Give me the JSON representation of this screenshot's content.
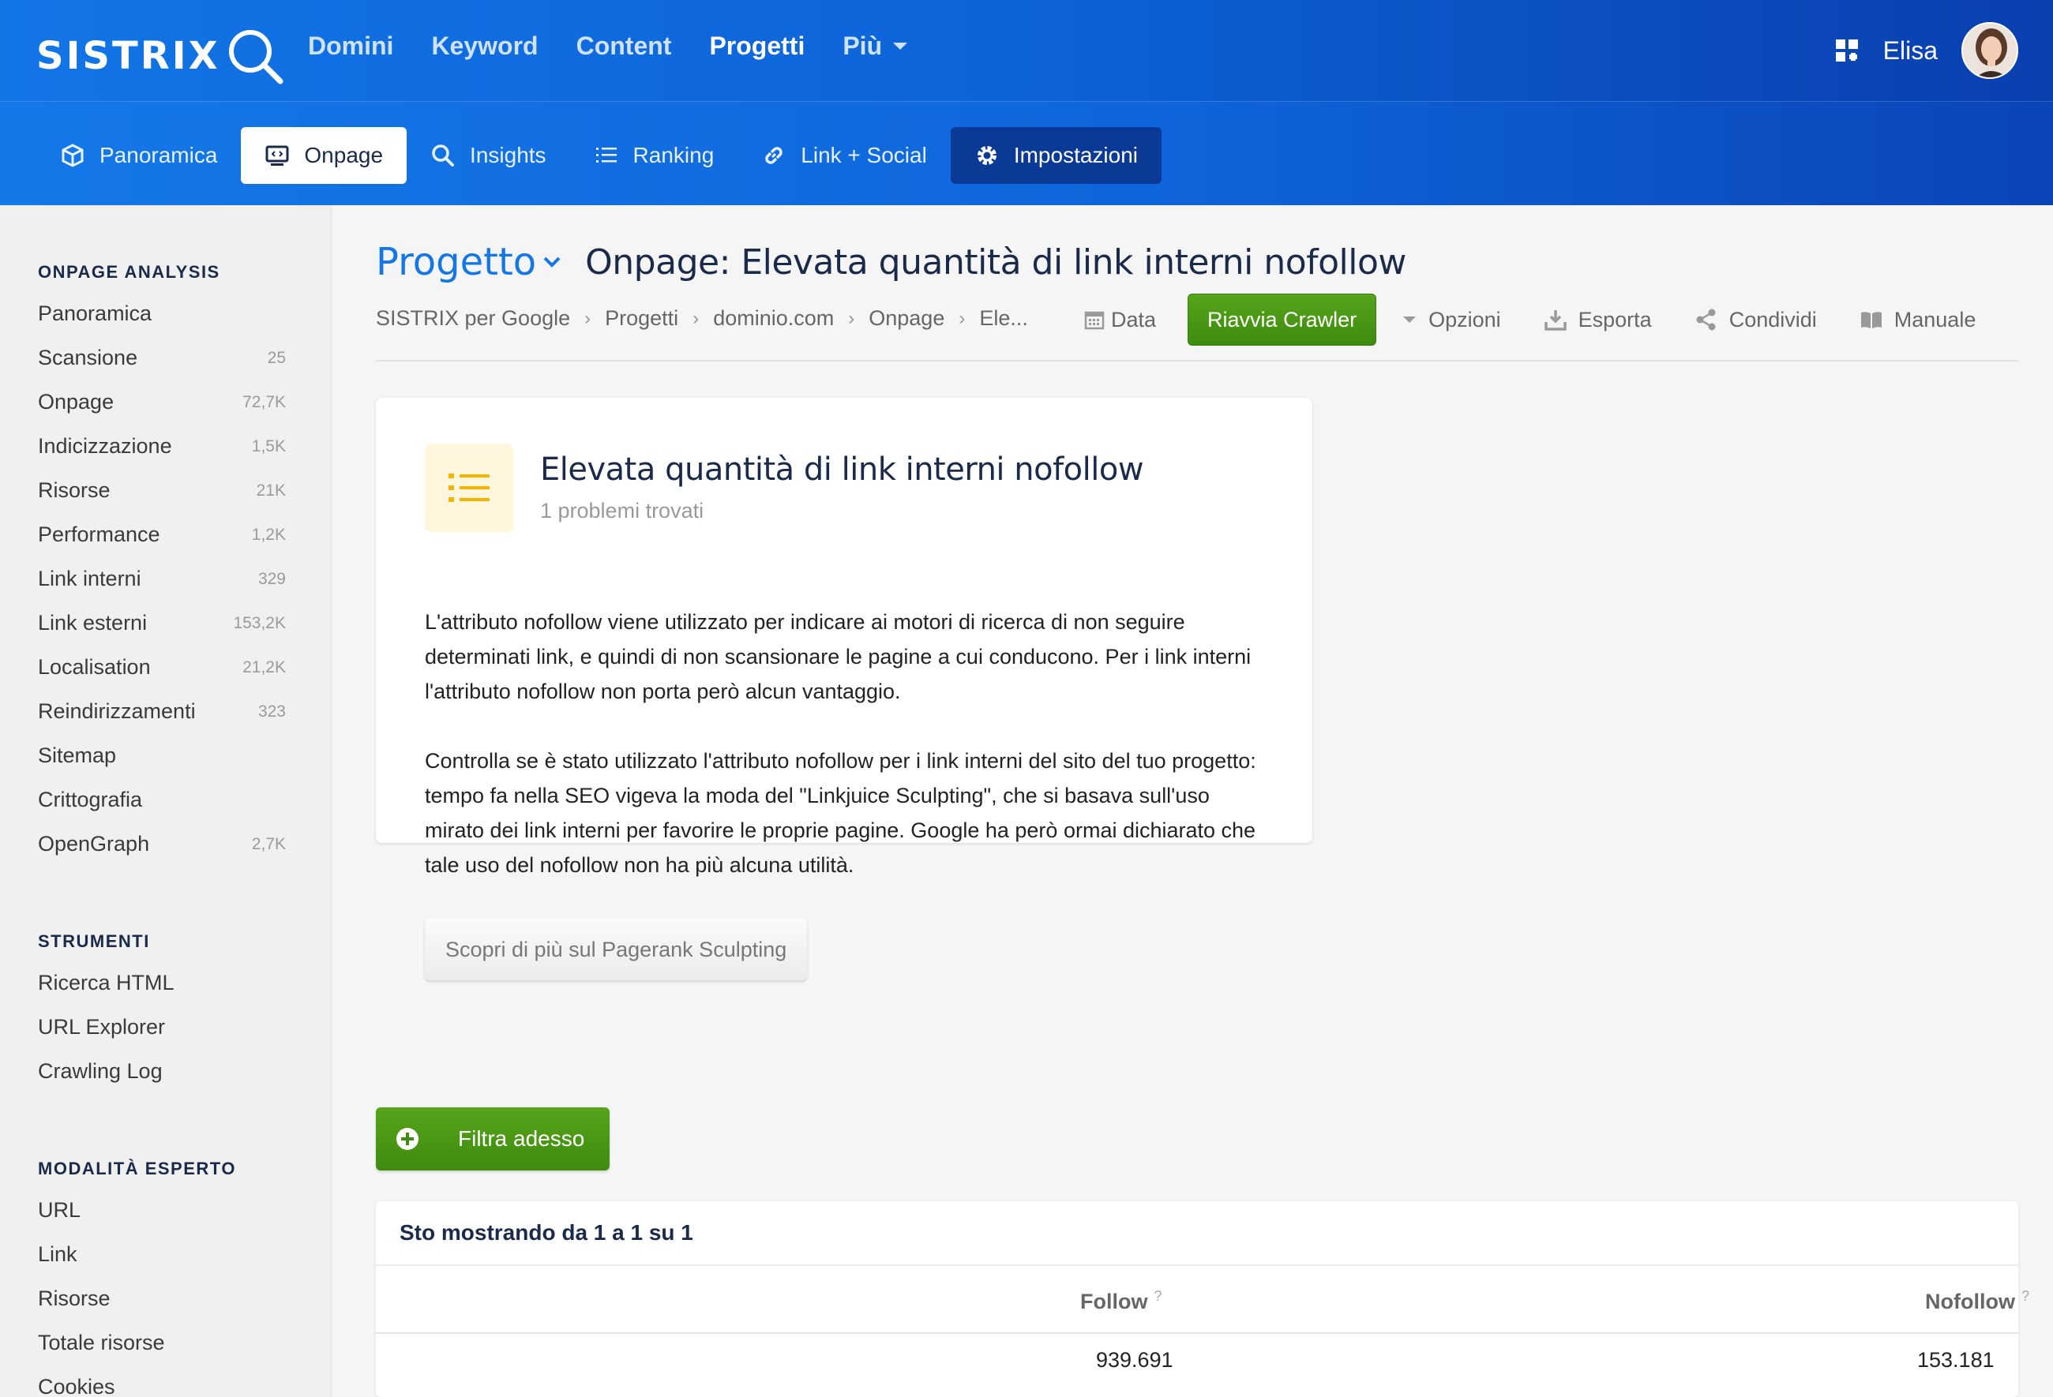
{
  "brand": {
    "logo_text": "SISTRIX"
  },
  "topnav": [
    {
      "label": "Domini",
      "active": false
    },
    {
      "label": "Keyword",
      "active": false
    },
    {
      "label": "Content",
      "active": false
    },
    {
      "label": "Progetti",
      "active": true
    },
    {
      "label": "Più",
      "active": false,
      "dropdown": true
    }
  ],
  "user": {
    "name": "Elisa",
    "apps_icon": "grid-icon"
  },
  "subnav": [
    {
      "label": "Panoramica",
      "icon": "cube-icon"
    },
    {
      "label": "Onpage",
      "icon": "monitor-code-icon",
      "active": true
    },
    {
      "label": "Insights",
      "icon": "search-icon"
    },
    {
      "label": "Ranking",
      "icon": "list-icon"
    },
    {
      "label": "Link + Social",
      "icon": "link-icon"
    },
    {
      "label": "Impostazioni",
      "icon": "gear-icon"
    }
  ],
  "sidebar": {
    "sections": [
      {
        "title": "ONPAGE ANALYSIS",
        "items": [
          {
            "label": "Panoramica",
            "count": ""
          },
          {
            "label": "Scansione",
            "count": "25"
          },
          {
            "label": "Onpage",
            "count": "72,7K"
          },
          {
            "label": "Indicizzazione",
            "count": "1,5K"
          },
          {
            "label": "Risorse",
            "count": "21K"
          },
          {
            "label": "Performance",
            "count": "1,2K"
          },
          {
            "label": "Link interni",
            "count": "329"
          },
          {
            "label": "Link esterni",
            "count": "153,2K"
          },
          {
            "label": "Localisation",
            "count": "21,2K"
          },
          {
            "label": "Reindirizzamenti",
            "count": "323"
          },
          {
            "label": "Sitemap",
            "count": ""
          },
          {
            "label": "Crittografia",
            "count": ""
          },
          {
            "label": "OpenGraph",
            "count": "2,7K"
          }
        ]
      },
      {
        "title": "STRUMENTI",
        "items": [
          {
            "label": "Ricerca HTML",
            "count": ""
          },
          {
            "label": "URL Explorer",
            "count": ""
          },
          {
            "label": "Crawling Log",
            "count": ""
          }
        ]
      },
      {
        "title": "MODALITÀ ESPERTO",
        "items": [
          {
            "label": "URL",
            "count": ""
          },
          {
            "label": "Link",
            "count": ""
          },
          {
            "label": "Risorse",
            "count": ""
          },
          {
            "label": "Totale risorse",
            "count": ""
          },
          {
            "label": "Cookies",
            "count": ""
          }
        ]
      }
    ]
  },
  "header": {
    "project_label": "Progetto",
    "title": "Onpage: Elevata quantità di link interni nofollow"
  },
  "breadcrumb": [
    "SISTRIX per Google",
    "Progetti",
    "dominio.com",
    "Onpage",
    "Ele..."
  ],
  "toolbar": {
    "data_label": "Data",
    "restart_label": "Riavvia Crawler",
    "options_label": "Opzioni",
    "export_label": "Esporta",
    "share_label": "Condividi",
    "manual_label": "Manuale"
  },
  "card": {
    "title": "Elevata quantità di link interni nofollow",
    "subtitle": "1 problemi trovati",
    "paragraph1": "L'attributo nofollow viene utilizzato per indicare ai motori di ricerca di non seguire determinati link, e quindi di non scansionare le pagine a cui conducono. Per i link interni l'attributo nofollow non porta però alcun vantaggio.",
    "paragraph2": "Controlla se è stato utilizzato l'attributo nofollow per i link interni del sito del tuo progetto: tempo fa nella SEO vigeva la moda del \"Linkjuice Sculpting\", che si basava sull'uso mirato dei link interni per favorire le proprie pagine. Google ha però ormai dichiarato che tale uso del nofollow non ha più alcuna utilità.",
    "button_label": "Scopri di più sul Pagerank Sculpting"
  },
  "filter": {
    "label": "Filtra adesso"
  },
  "table": {
    "summary": "Sto mostrando da 1 a 1 su 1",
    "columns": [
      {
        "label": "Follow",
        "help": "?"
      },
      {
        "label": "Nofollow",
        "help": "?"
      }
    ],
    "rows": [
      [
        "939.691",
        "153.181"
      ]
    ]
  },
  "colors": {
    "brand_blue": "#1275e6",
    "green": "#4a9a16",
    "title_navy": "#1a2a4a"
  }
}
